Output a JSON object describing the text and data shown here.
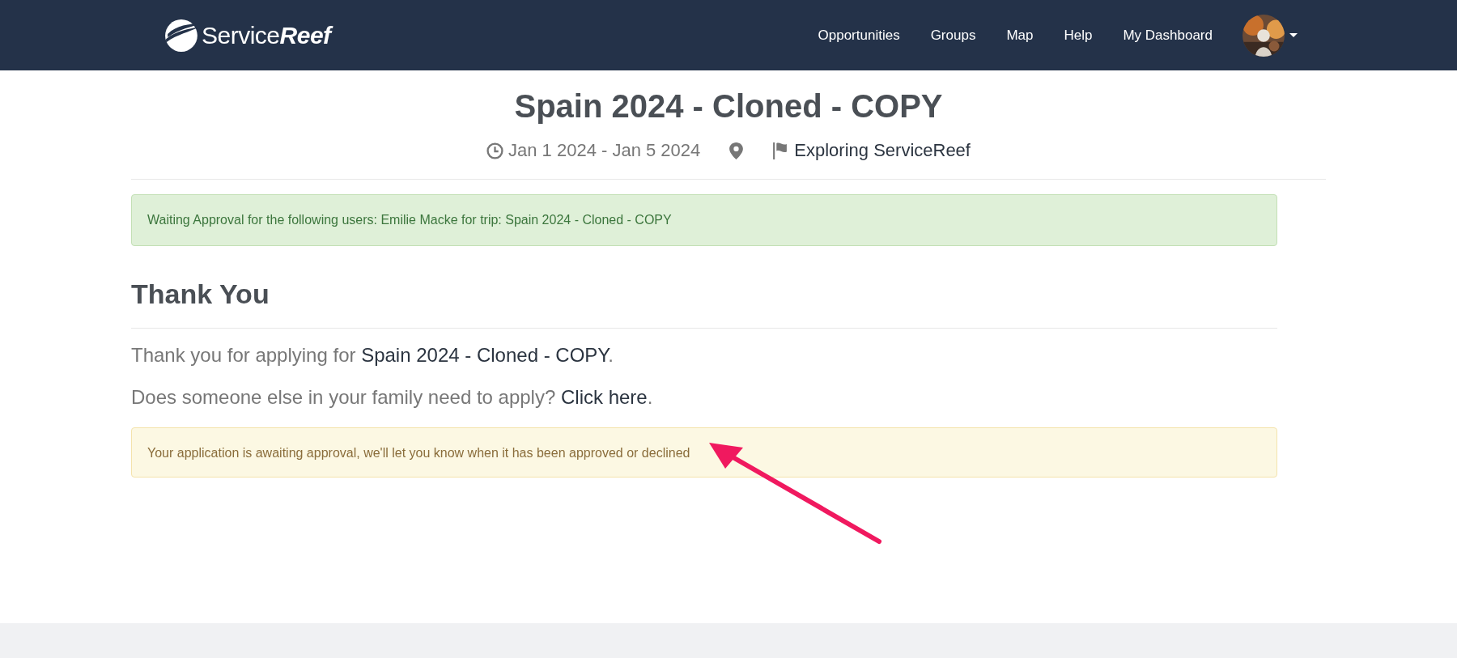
{
  "header": {
    "logo": {
      "light": "Service",
      "bold": "Reef"
    },
    "nav": [
      {
        "label": "Opportunities"
      },
      {
        "label": "Groups"
      },
      {
        "label": "Map"
      },
      {
        "label": "Help"
      },
      {
        "label": "My Dashboard"
      }
    ]
  },
  "trip": {
    "title": "Spain 2024 - Cloned - COPY",
    "dates": "Jan 1 2024 - Jan 5 2024",
    "organization": "Exploring ServiceReef"
  },
  "alerts": [
    {
      "kind": "success",
      "text": "Waiting Approval for the following users: Emilie Macke for trip: Spain 2024 - Cloned - COPY"
    }
  ],
  "thank_you": {
    "heading": "Thank You",
    "paragraphs": [
      {
        "text": "Thank you for applying for ",
        "link": "Spain 2024 - Cloned - COPY",
        "end": "."
      },
      {
        "text": "Does someone else in your family need to apply? ",
        "link": "Click here",
        "end": "."
      }
    ],
    "notice": {
      "kind": "warning",
      "text": "Your application is awaiting approval, we'll let you know when it has been approved or declined"
    }
  },
  "annotation": {
    "kind": "arrow"
  }
}
